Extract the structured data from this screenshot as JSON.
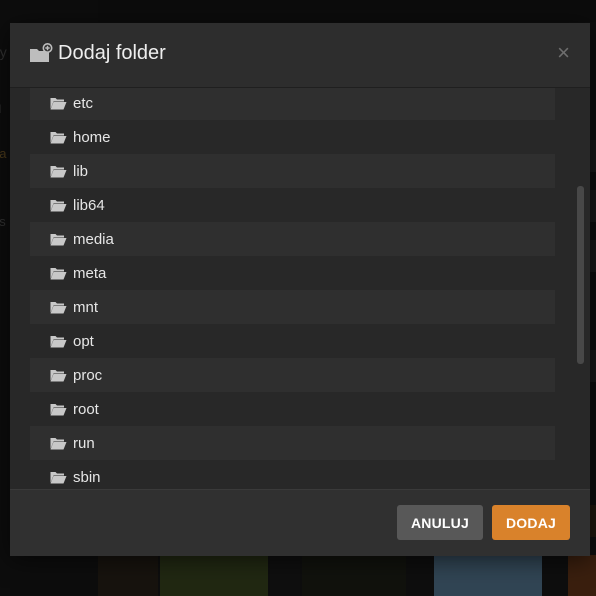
{
  "modal": {
    "title": "Dodaj folder",
    "close_symbol": "×",
    "folders": [
      "etc",
      "home",
      "lib",
      "lib64",
      "media",
      "meta",
      "mnt",
      "opt",
      "proc",
      "root",
      "run",
      "sbin"
    ],
    "cancel_label": "ANULUJ",
    "add_label": "DODAJ"
  },
  "background": {
    "left_fragments": [
      "dy",
      "ól",
      "da",
      "ns"
    ]
  },
  "colors": {
    "accent": "#d9822b",
    "modal_bg": "#282828",
    "row_alt": "#2f2f2f",
    "text": "#e6e6e6"
  },
  "icons": {
    "header": "add-folder-icon",
    "row": "folder-open-icon",
    "close": "close-icon"
  }
}
